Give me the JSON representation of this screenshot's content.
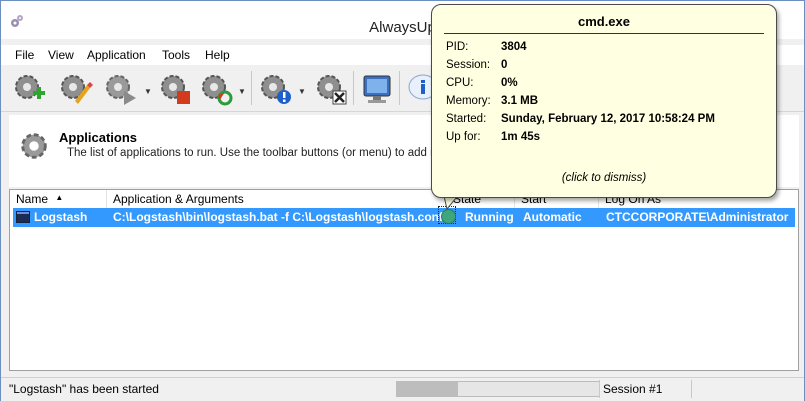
{
  "window": {
    "title": "AlwaysUp"
  },
  "menu": [
    "File",
    "View",
    "Application",
    "Tools",
    "Help"
  ],
  "toolbar": {
    "icons": [
      "add-application-icon",
      "edit-application-icon",
      "start-application-icon",
      "stop-application-icon",
      "restart-application-icon",
      "application-info-icon",
      "delete-application-icon",
      "computer-icon",
      "info-icon"
    ]
  },
  "header": {
    "title": "Applications",
    "description": "The list of applications to run. Use the toolbar buttons (or menu) to add new"
  },
  "columns": [
    "Name",
    "Application & Arguments",
    "State",
    "Start",
    "Log On As"
  ],
  "rows": [
    {
      "name": "Logstash",
      "app": "C:\\Logstash\\bin\\logstash.bat -f C:\\Logstash\\logstash.conf",
      "state": "Running",
      "start": "Automatic",
      "logon": "CTCCORPORATE\\Administrator"
    }
  ],
  "tooltip": {
    "title": "cmd.exe",
    "fields": [
      {
        "label": "PID:",
        "value": "3804"
      },
      {
        "label": "Session:",
        "value": "0"
      },
      {
        "label": "CPU:",
        "value": "0%"
      },
      {
        "label": "Memory:",
        "value": "3.1 MB"
      },
      {
        "label": "Started:",
        "value": "Sunday, February 12, 2017 10:58:24 PM"
      },
      {
        "label": "Up for:",
        "value": "1m 45s"
      }
    ],
    "dismiss": "(click to dismiss)"
  },
  "status": {
    "message": "\"Logstash\" has been started",
    "progress": 0.3,
    "session": "Session #1"
  },
  "colors": {
    "selection": "#3399ff",
    "running": "#3ea67e",
    "tooltip_bg": "#ffffe1"
  }
}
